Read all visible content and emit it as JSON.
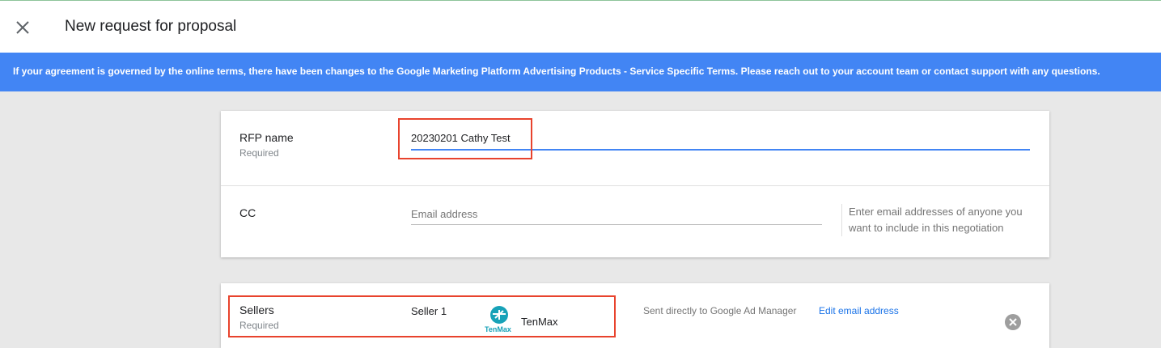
{
  "header": {
    "title": "New request for proposal",
    "close_icon": "close-icon"
  },
  "banner": {
    "text": "If your agreement is governed by the online terms, there have been changes to the Google Marketing Platform Advertising Products - Service Specific Terms. Please reach out to your account team or contact support with any questions."
  },
  "rfp": {
    "label": "RFP name",
    "sublabel": "Required",
    "value": "20230201 Cathy Test"
  },
  "cc": {
    "label": "CC",
    "placeholder": "Email address",
    "helper": "Enter email addresses of anyone you want to include in this negotiation"
  },
  "sellers": {
    "label": "Sellers",
    "sublabel": "Required",
    "items": [
      {
        "index_label": "Seller 1",
        "logo_text": "TenMax",
        "name": "TenMax",
        "status": "Sent directly to Google Ad Manager",
        "edit_label": "Edit email address",
        "remove_icon": "remove-circle-icon"
      }
    ]
  },
  "colors": {
    "banner": "#4285f4",
    "accent": "#1a73e8",
    "highlight": "#e8432d",
    "logo": "#17a2b8"
  }
}
